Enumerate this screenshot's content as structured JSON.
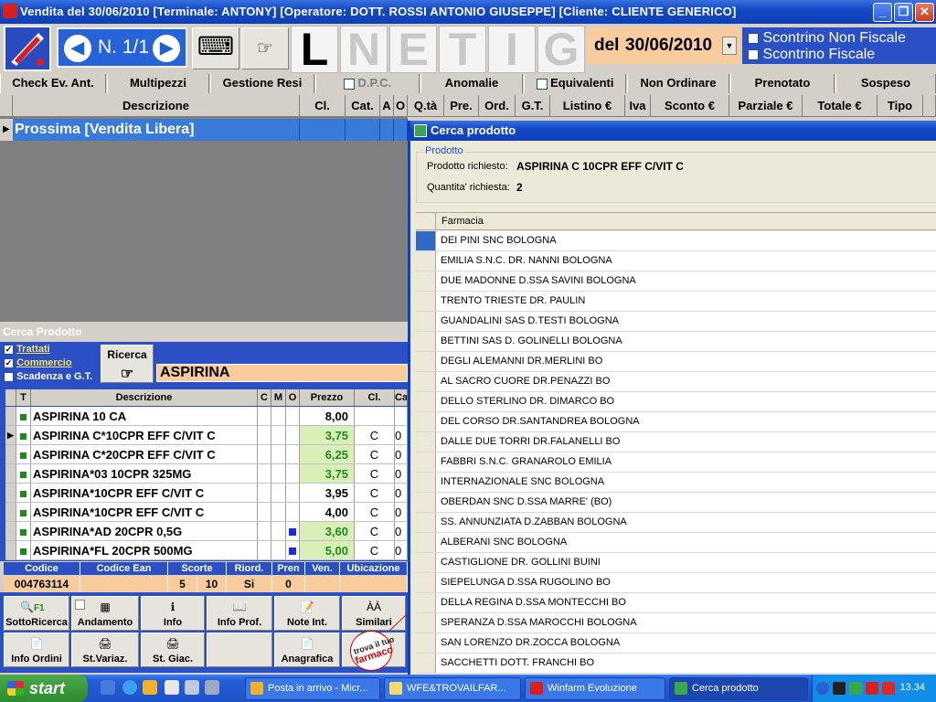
{
  "window": {
    "title": "Vendita del 30/06/2010 [Terminale: ANTONY] [Operatore: DOTT. ROSSI ANTONIO GIUSEPPE]  [Cliente: CLIENTE GENERICO]",
    "minimize": "_",
    "restore": "❐",
    "close": "✕"
  },
  "toolbar": {
    "nav_prev": "◀",
    "nav_next": "▶",
    "nav_counter": "N. 1/1",
    "keyboard_icon": "⌨",
    "hand_icon": "☞",
    "letters": [
      "L",
      "N",
      "E",
      "T",
      "I",
      "G"
    ],
    "date_label": "del",
    "date_value": "30/06/2010",
    "date_dropdown": "▼",
    "receipt_non_fiscale": "Scontrino Non Fiscale",
    "receipt_fiscale": "Scontrino Fiscale"
  },
  "funcbar": [
    "Check Ev. Ant.",
    "Multipezzi",
    "Gestione Resi",
    "D.P.C.",
    "Anomalie",
    "Equivalenti",
    "Non Ordinare",
    "Prenotato",
    "Sospeso"
  ],
  "sale_grid": {
    "columns": [
      "Descrizione",
      "Cl.",
      "Cat.",
      "A",
      "O",
      "Q.tà",
      "Pre.",
      "Ord.",
      "G.T.",
      "Listino €",
      "Iva",
      "Sconto €",
      "Parziale €",
      "Totale €",
      "Tipo"
    ],
    "row_pointer": "▶",
    "current_row": "Prossima [Vendita Libera]"
  },
  "cerca_prodotto": {
    "panel_title": "Cerca Prodotto",
    "opt_trattati": "Trattati",
    "opt_commercio": "Commercio",
    "opt_scadenza": "Scadenza e G.T.",
    "check_mark": "✓",
    "ricerca_label": "Ricerca",
    "ricerca_icon": "☞",
    "search_value": "ASPIRINA",
    "columns": [
      "T",
      "Descrizione",
      "C",
      "M",
      "O",
      "Prezzo",
      "Cl.",
      "Ca"
    ],
    "rows": [
      {
        "desc": "ASPIRINA 10 CA",
        "prezzo": "8,00",
        "cl": "",
        "ca": "",
        "green": false,
        "blue": false,
        "pointer": ""
      },
      {
        "desc": "ASPIRINA C*10CPR EFF C/VIT C",
        "prezzo": "3,75",
        "cl": "C",
        "ca": "0",
        "green": true,
        "blue": false,
        "pointer": "▶"
      },
      {
        "desc": "ASPIRINA C*20CPR EFF C/VIT C",
        "prezzo": "6,25",
        "cl": "C",
        "ca": "0",
        "green": true,
        "blue": false,
        "pointer": ""
      },
      {
        "desc": "ASPIRINA*03 10CPR 325MG",
        "prezzo": "3,75",
        "cl": "C",
        "ca": "0",
        "green": true,
        "blue": false,
        "pointer": ""
      },
      {
        "desc": "ASPIRINA*10CPR EFF C/VIT C",
        "prezzo": "3,95",
        "cl": "C",
        "ca": "0",
        "green": false,
        "blue": false,
        "pointer": ""
      },
      {
        "desc": "ASPIRINA*10CPR EFF C/VIT C",
        "prezzo": "4,00",
        "cl": "C",
        "ca": "0",
        "green": false,
        "blue": false,
        "pointer": ""
      },
      {
        "desc": "ASPIRINA*AD 20CPR 0,5G",
        "prezzo": "3,60",
        "cl": "C",
        "ca": "0",
        "green": true,
        "blue": true,
        "pointer": ""
      },
      {
        "desc": "ASPIRINA*FL 20CPR 500MG",
        "prezzo": "5,00",
        "cl": "C",
        "ca": "0",
        "green": true,
        "blue": true,
        "pointer": ""
      }
    ]
  },
  "info": {
    "headers": [
      "Codice",
      "Codice Ean",
      "Scorte",
      "Riord.",
      "Pren",
      "Ven.",
      "Ubicazione"
    ],
    "codice": "004763114",
    "ean": "",
    "scorte_1": "5",
    "scorte_2": "10",
    "riord": "Si",
    "pren": "0",
    "ven": "",
    "ubicazione": ""
  },
  "bottom_buttons": {
    "sottoricerca": "SottoRicerca",
    "f1": "F1",
    "andamento": "Andamento",
    "info": "Info",
    "info_prof": "Info Prof.",
    "note_int": "Note Int.",
    "similari": "Similari",
    "info_ordini": "Info Ordini",
    "st_variaz": "St.Variaz.",
    "st_giac": "St. Giac.",
    "anagrafica": "Anagrafica",
    "trova_logo_line1": "trova il tuo",
    "trova_logo_line2": "farmaco"
  },
  "dialog": {
    "title": "Cerca prodotto",
    "group_label": "Prodotto",
    "prodotto_label": "Prodotto richiesto:",
    "prodotto_value": "ASPIRINA C 10CPR EFF C/VIT C",
    "quantita_label": "Quantita' richiesta:",
    "quantita_value": "2",
    "list_header": "Farmacia",
    "farmacie": [
      "DEI PINI SNC BOLOGNA",
      "EMILIA S.N.C. DR. NANNI BOLOGNA",
      "DUE MADONNE D.SSA SAVINI BOLOGNA",
      "TRENTO TRIESTE DR. PAULIN",
      "GUANDALINI SAS D.TESTI BOLOGNA",
      "BETTINI SAS D. GOLINELLI BOLOGNA",
      "DEGLI ALEMANNI DR.MERLINI BO",
      "AL SACRO CUORE DR.PENAZZI BO",
      "DELLO STERLINO DR. DIMARCO BO",
      "DEL CORSO DR.SANTANDREA BOLOGNA",
      "DALLE DUE TORRI DR.FALANELLI BO",
      "FABBRI S.N.C. GRANAROLO EMILIA",
      "INTERNAZIONALE SNC BOLOGNA",
      "OBERDAN SNC D.SSA MARRE' (BO)",
      "SS. ANNUNZIATA D.ZABBAN BOLOGNA",
      "ALBERANI SNC  BOLOGNA",
      "CASTIGLIONE DR. GOLLINI BUINI",
      "SIEPELUNGA D.SSA RUGOLINO BO",
      "DELLA REGINA D.SSA MONTECCHI BO",
      "SPERANZA D.SSA MAROCCHI BOLOGNA",
      "SAN LORENZO DR.ZOCCA BOLOGNA",
      "SACCHETTI DOTT. FRANCHI BO"
    ]
  },
  "taskbar": {
    "start": "start",
    "tasks": [
      "Posta in arrivo - Micr...",
      "WFE&TROVAILFAR...",
      "Winfarm Evoluzione",
      "Cerca prodotto"
    ],
    "clock": "13.34"
  }
}
